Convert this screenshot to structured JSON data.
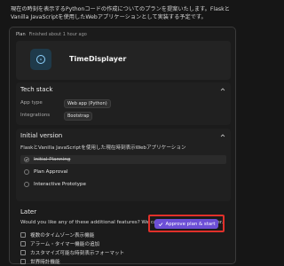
{
  "intro": "現在の時刻を表示するPythonコードの作成についてのプランを提案いたします。FlaskとVanilla JavaScriptを使用したWebアプリケーションとして実装する予定です。",
  "plan": {
    "label": "Plan",
    "status": "Finished about 1 hour ago",
    "app_name": "TimeDisplayer",
    "icon": "clock-icon"
  },
  "tech_stack": {
    "title": "Tech stack",
    "app_type_label": "App type",
    "app_type_value": "Web app (Python)",
    "integrations_label": "Integrations",
    "integrations_value": "Bootstrap"
  },
  "initial_version": {
    "title": "Initial version",
    "description": "FlaskとVanilla JavaScriptを使用した現在時刻表示Webアプリケーション",
    "steps": [
      "Initial Planning",
      "Plan Approval",
      "Interactive Prototype"
    ]
  },
  "later": {
    "title": "Later",
    "question": "Would you like any of these additional features? We can also make changes later.",
    "features": [
      "複数のタイムゾーン表示機能",
      "アラーム・タイマー機能の追加",
      "カスタマイズ可能な時刻表示フォーマット",
      "世界時計機能"
    ]
  },
  "approve_label": "Approve plan & start",
  "colors": {
    "accent": "#6c4fd6",
    "highlight": "#e0302a"
  }
}
